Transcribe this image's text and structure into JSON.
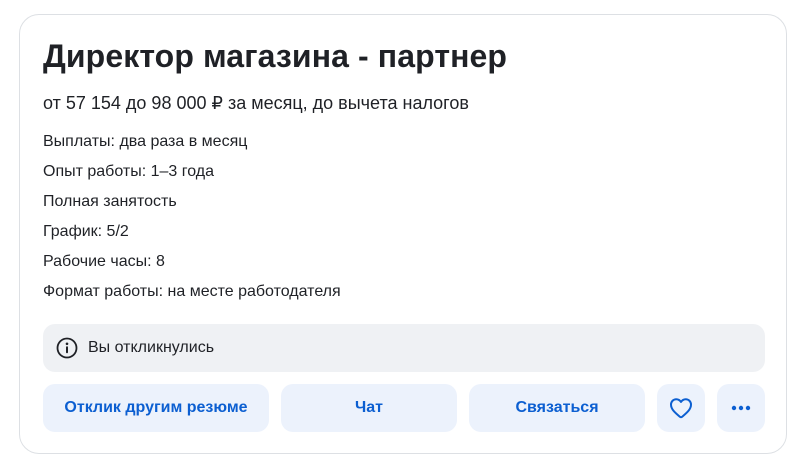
{
  "vacancy": {
    "title": "Директор магазина - партнер",
    "salary": "от 57 154 до 98 000 ₽ за месяц, до вычета налогов",
    "details": [
      "Выплаты: два раза в месяц",
      "Опыт работы: 1–3 года",
      "Полная занятость",
      "График: 5/2",
      "Рабочие часы: 8",
      "Формат работы: на месте работодателя"
    ]
  },
  "notice": {
    "icon": "info-icon",
    "text": "Вы откликнулись"
  },
  "actions": {
    "respond_other_resume": "Отклик другим резюме",
    "chat": "Чат",
    "contact": "Связаться",
    "like_icon": "heart-icon",
    "more_icon": "more-dots-icon"
  },
  "colors": {
    "accent": "#0c5fd1",
    "button_bg": "#ecf2fc",
    "notice_bg": "#eff1f4",
    "text": "#1f2126",
    "card_border": "#dde0e4"
  }
}
